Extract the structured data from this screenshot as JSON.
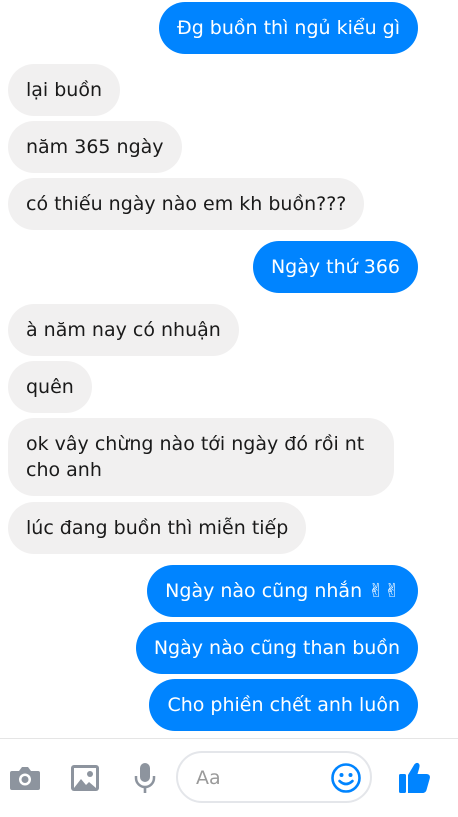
{
  "messages": [
    {
      "text": "Đg buồn thì ngủ kiểu gì",
      "from": "me"
    },
    {
      "text": "lại buồn",
      "from": "them"
    },
    {
      "text": "năm 365 ngày",
      "from": "them"
    },
    {
      "text": "có thiếu ngày nào em kh buồn???",
      "from": "them"
    },
    {
      "text": "Ngày thứ 366",
      "from": "me"
    },
    {
      "text": "à năm nay có nhuận",
      "from": "them"
    },
    {
      "text": "quên",
      "from": "them"
    },
    {
      "text": "ok vây chừng nào tới ngày đó rồi nt cho anh",
      "from": "them"
    },
    {
      "text": "lúc đang buồn thì miễn tiếp",
      "from": "them"
    },
    {
      "text": "Ngày nào cũng nhắn ✌✌",
      "from": "me"
    },
    {
      "text": "Ngày nào cũng than buồn",
      "from": "me"
    },
    {
      "text": "Cho phiền chết anh luôn",
      "from": "me"
    }
  ],
  "composer": {
    "placeholder": "Aa"
  },
  "icons": {
    "camera": "camera-icon",
    "gallery": "image-icon",
    "mic": "microphone-icon",
    "emoji": "smiley-icon",
    "like": "thumbs-up-icon"
  },
  "colors": {
    "outgoing_bubble": "#0084ff",
    "incoming_bubble": "#f1f0f0",
    "toolbar_icon": "#8d949e",
    "accent": "#0084ff"
  }
}
